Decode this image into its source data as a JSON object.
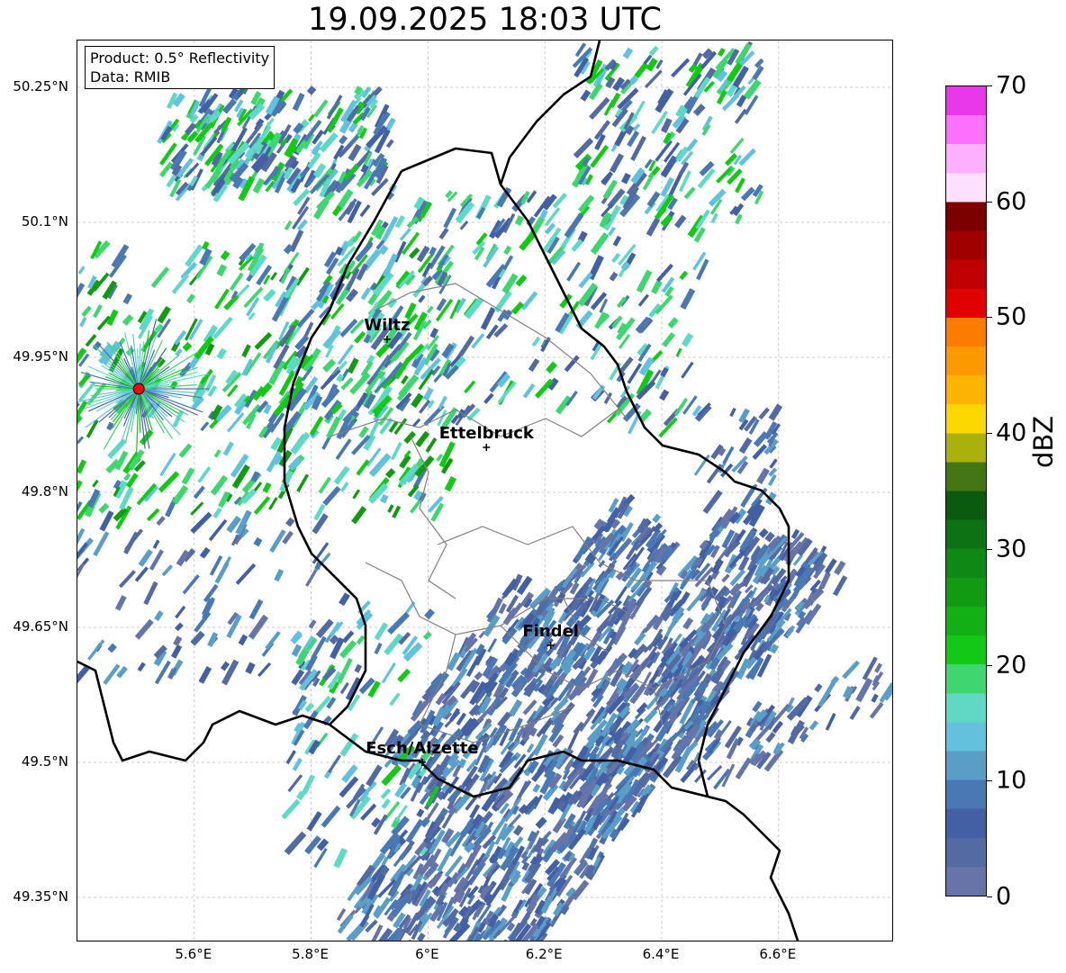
{
  "title": "19.09.2025 18:03 UTC",
  "info": {
    "product": "Product: 0.5° Reflectivity",
    "data": "Data: RMIB"
  },
  "map": {
    "lon_range": [
      5.4,
      6.8
    ],
    "lat_range": [
      49.3,
      50.3
    ],
    "lat_ticks": [
      {
        "value": 50.25,
        "label": "50.25°N"
      },
      {
        "value": 50.1,
        "label": "50.1°N"
      },
      {
        "value": 49.95,
        "label": "49.95°N"
      },
      {
        "value": 49.8,
        "label": "49.8°N"
      },
      {
        "value": 49.65,
        "label": "49.65°N"
      },
      {
        "value": 49.5,
        "label": "49.5°N"
      },
      {
        "value": 49.35,
        "label": "49.35°N"
      }
    ],
    "lon_ticks": [
      {
        "value": 5.6,
        "label": "5.6°E"
      },
      {
        "value": 5.8,
        "label": "5.8°E"
      },
      {
        "value": 6.0,
        "label": "6°E"
      },
      {
        "value": 6.2,
        "label": "6.2°E"
      },
      {
        "value": 6.4,
        "label": "6.4°E"
      },
      {
        "value": 6.6,
        "label": "6.6°E"
      }
    ],
    "cities": [
      {
        "name": "Wiltz",
        "lon": 5.93,
        "lat": 49.97
      },
      {
        "name": "Ettelbruck",
        "lon": 6.1,
        "lat": 49.85
      },
      {
        "name": "Findel",
        "lon": 6.21,
        "lat": 49.63
      },
      {
        "name": "Esch/Alzette",
        "lon": 5.99,
        "lat": 49.5
      }
    ],
    "radar_site": {
      "lon": 5.505,
      "lat": 49.915
    },
    "border_color": "#000000",
    "canton_color": "#808080"
  },
  "colorbar": {
    "unit": "dBZ",
    "range": [
      0,
      70
    ],
    "ticks": [
      "0",
      "10",
      "20",
      "30",
      "40",
      "50",
      "60",
      "70"
    ],
    "colors": [
      "#6674a8",
      "#536aa2",
      "#4360a4",
      "#4a78b2",
      "#5a9ec8",
      "#62c2de",
      "#5fd9c4",
      "#3fd670",
      "#14c818",
      "#13b015",
      "#129a13",
      "#108816",
      "#0c7214",
      "#0a5a10",
      "#457614",
      "#aab00c",
      "#fcd800",
      "#fcb400",
      "#fc9800",
      "#fc7c00",
      "#e00000",
      "#c00000",
      "#a00000",
      "#7c0000",
      "#fde0fd",
      "#fdb0fd",
      "#fd70fd",
      "#e838e8"
    ]
  }
}
